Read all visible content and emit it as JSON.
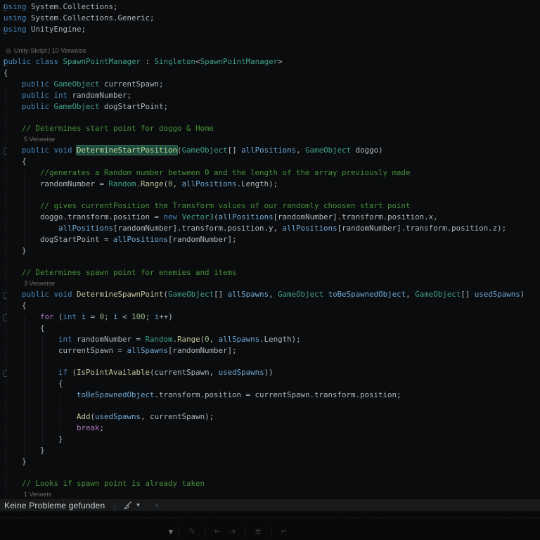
{
  "colors": {
    "background": "#0b0c0e",
    "plain": "#b0b5b7",
    "keyword": "#4584b8",
    "type": "#3fa089",
    "variable": "#6fa8d4",
    "number": "#97b585",
    "comment": "#459038",
    "method": "#c6c49c",
    "control": "#b179c0",
    "lens": "#6d6d6d",
    "highlight_bg": "#1c4a3e",
    "highlight_border": "#35684f",
    "highlight_text": "#c3d490",
    "status_bg": "#17191b",
    "status_text": "#cdd0d1"
  },
  "editor": {
    "lines": [
      {
        "fold": 1,
        "t": [
          [
            "k",
            "using"
          ],
          [
            "p",
            " System.Collections;"
          ]
        ]
      },
      {
        "t": [
          [
            "k",
            "using"
          ],
          [
            "p",
            " System.Collections.Generic;"
          ]
        ]
      },
      {
        "fold": 1,
        "t": [
          [
            "k",
            "using"
          ],
          [
            "p",
            " UnityEngine;"
          ]
        ]
      },
      {
        "b": 1
      },
      {
        "lens": "Unity-Skript | 10 Verweise",
        "icon": "unity",
        "indent": 0
      },
      {
        "fold": 1,
        "t": [
          [
            "k",
            "public class "
          ],
          [
            "t",
            "SpawnPointManager"
          ],
          [
            "p",
            " : "
          ],
          [
            "t",
            "Singleton"
          ],
          [
            "p",
            "<"
          ],
          [
            "t",
            "SpawnPointManager"
          ],
          [
            "p",
            ">"
          ]
        ]
      },
      {
        "t": [
          [
            "p",
            "{"
          ]
        ]
      },
      {
        "t": [
          [
            "p",
            "    "
          ],
          [
            "k",
            "public "
          ],
          [
            "t",
            "GameObject"
          ],
          [
            "p",
            " currentSpawn;"
          ]
        ]
      },
      {
        "t": [
          [
            "p",
            "    "
          ],
          [
            "k",
            "public int"
          ],
          [
            "p",
            " randomNumber;"
          ]
        ]
      },
      {
        "t": [
          [
            "p",
            "    "
          ],
          [
            "k",
            "public "
          ],
          [
            "t",
            "GameObject"
          ],
          [
            "p",
            " dogStartPoint;"
          ]
        ]
      },
      {
        "b": 1
      },
      {
        "t": [
          [
            "c",
            "    // Determines start point for doggo & Home"
          ]
        ]
      },
      {
        "lens": "5 Verweise",
        "indent": 4
      },
      {
        "fold": 1,
        "t": [
          [
            "p",
            "    "
          ],
          [
            "k",
            "public void "
          ],
          [
            "h",
            "DetermineStartPosition"
          ],
          [
            "p",
            "("
          ],
          [
            "t",
            "GameObject"
          ],
          [
            "p",
            "[] "
          ],
          [
            "v",
            "allPositions"
          ],
          [
            "p",
            ", "
          ],
          [
            "t",
            "GameObject"
          ],
          [
            "p",
            " doggo)"
          ]
        ]
      },
      {
        "t": [
          [
            "p",
            "    {"
          ]
        ]
      },
      {
        "t": [
          [
            "c",
            "        //generates a Random number between 0 and the length of the array previously made"
          ]
        ]
      },
      {
        "t": [
          [
            "p",
            "        randomNumber = "
          ],
          [
            "t",
            "Random"
          ],
          [
            "p",
            "."
          ],
          [
            "m",
            "Range"
          ],
          [
            "p",
            "("
          ],
          [
            "n",
            "0"
          ],
          [
            "p",
            ", "
          ],
          [
            "v",
            "allPositions"
          ],
          [
            "p",
            ".Length);"
          ]
        ]
      },
      {
        "b": 1
      },
      {
        "t": [
          [
            "c",
            "        // gives currentPosition the Transform values of our randomly choosen start point"
          ]
        ]
      },
      {
        "t": [
          [
            "p",
            "        doggo.transform.position = "
          ],
          [
            "k",
            "new"
          ],
          [
            "p",
            " "
          ],
          [
            "t",
            "Vector3"
          ],
          [
            "p",
            "("
          ],
          [
            "v",
            "allPositions"
          ],
          [
            "p",
            "[randomNumber].transform.position.x,"
          ]
        ]
      },
      {
        "t": [
          [
            "p",
            "            "
          ],
          [
            "v",
            "allPositions"
          ],
          [
            "p",
            "[randomNumber].transform.position.y, "
          ],
          [
            "v",
            "allPositions"
          ],
          [
            "p",
            "[randomNumber].transform.position.z);"
          ]
        ]
      },
      {
        "t": [
          [
            "p",
            "        dogStartPoint = "
          ],
          [
            "v",
            "allPositions"
          ],
          [
            "p",
            "[randomNumber];"
          ]
        ]
      },
      {
        "t": [
          [
            "p",
            "    }"
          ]
        ]
      },
      {
        "b": 1
      },
      {
        "t": [
          [
            "c",
            "    // Determines spawn point for enemies and items"
          ]
        ]
      },
      {
        "lens": "3 Verweise",
        "indent": 4
      },
      {
        "fold": 1,
        "t": [
          [
            "p",
            "    "
          ],
          [
            "k",
            "public void "
          ],
          [
            "m",
            "DetermineSpawnPoint"
          ],
          [
            "p",
            "("
          ],
          [
            "t",
            "GameObject"
          ],
          [
            "p",
            "[] "
          ],
          [
            "v",
            "allSpawns"
          ],
          [
            "p",
            ", "
          ],
          [
            "t",
            "GameObject"
          ],
          [
            "p",
            " "
          ],
          [
            "v",
            "toBeSpawnedObject"
          ],
          [
            "p",
            ", "
          ],
          [
            "t",
            "GameObject"
          ],
          [
            "p",
            "[] "
          ],
          [
            "v",
            "usedSpawns"
          ],
          [
            "p",
            ")"
          ]
        ]
      },
      {
        "t": [
          [
            "p",
            "    {"
          ]
        ]
      },
      {
        "fold": 1,
        "t": [
          [
            "p",
            "        "
          ],
          [
            "x",
            "for"
          ],
          [
            "p",
            " ("
          ],
          [
            "k",
            "int"
          ],
          [
            "p",
            " "
          ],
          [
            "v",
            "i"
          ],
          [
            "p",
            " = "
          ],
          [
            "n",
            "0"
          ],
          [
            "p",
            "; "
          ],
          [
            "v",
            "i"
          ],
          [
            "p",
            " < "
          ],
          [
            "n",
            "100"
          ],
          [
            "p",
            "; "
          ],
          [
            "v",
            "i"
          ],
          [
            "p",
            "++)"
          ]
        ]
      },
      {
        "t": [
          [
            "p",
            "        {"
          ]
        ]
      },
      {
        "t": [
          [
            "p",
            "            "
          ],
          [
            "k",
            "int"
          ],
          [
            "p",
            " randomNumber = "
          ],
          [
            "t",
            "Random"
          ],
          [
            "p",
            "."
          ],
          [
            "m",
            "Range"
          ],
          [
            "p",
            "("
          ],
          [
            "n",
            "0"
          ],
          [
            "p",
            ", "
          ],
          [
            "v",
            "allSpawns"
          ],
          [
            "p",
            ".Length);"
          ]
        ]
      },
      {
        "t": [
          [
            "p",
            "            currentSpawn = "
          ],
          [
            "v",
            "allSpawns"
          ],
          [
            "p",
            "[randomNumber];"
          ]
        ]
      },
      {
        "b": 1
      },
      {
        "fold": 1,
        "t": [
          [
            "p",
            "            "
          ],
          [
            "k",
            "if"
          ],
          [
            "p",
            " ("
          ],
          [
            "m",
            "IsPointAvailable"
          ],
          [
            "p",
            "(currentSpawn, "
          ],
          [
            "v",
            "usedSpawns"
          ],
          [
            "p",
            "))"
          ]
        ]
      },
      {
        "t": [
          [
            "p",
            "            {"
          ]
        ]
      },
      {
        "t": [
          [
            "p",
            "                "
          ],
          [
            "v",
            "toBeSpawnedObject"
          ],
          [
            "p",
            ".transform.position = currentSpawn.transform.position;"
          ]
        ]
      },
      {
        "b": 1
      },
      {
        "t": [
          [
            "p",
            "                "
          ],
          [
            "m",
            "Add"
          ],
          [
            "p",
            "("
          ],
          [
            "v",
            "usedSpawns"
          ],
          [
            "p",
            ", currentSpawn);"
          ]
        ]
      },
      {
        "t": [
          [
            "p",
            "                "
          ],
          [
            "x",
            "break"
          ],
          [
            "p",
            ";"
          ]
        ]
      },
      {
        "t": [
          [
            "p",
            "            }"
          ]
        ]
      },
      {
        "t": [
          [
            "p",
            "        }"
          ]
        ]
      },
      {
        "t": [
          [
            "p",
            "    }"
          ]
        ]
      },
      {
        "b": 1
      },
      {
        "t": [
          [
            "c",
            "    // Looks if spawn point is already taken"
          ]
        ]
      },
      {
        "lens": "1 Verweis",
        "indent": 4
      }
    ]
  },
  "status_bar": {
    "message": "Keine Probleme gefunden",
    "divider": "|",
    "caret": "▼",
    "scroll_left": "◀",
    "icons": [
      "code-cleanup-broom-icon",
      "dropdown-caret-icon",
      "scroll-left-icon"
    ]
  },
  "bottom_toolbar": {
    "combo_caret": "▼",
    "icons": [
      "dropdown-caret-icon",
      "edit-lines-icon",
      "outdent-icon",
      "indent-icon",
      "line-list-icon",
      "line-break-icon"
    ],
    "icon_glyphs": {
      "edit": "✎",
      "outdent": "⇤",
      "indent": "⇥",
      "list": "≣",
      "wrap": "↵"
    }
  }
}
